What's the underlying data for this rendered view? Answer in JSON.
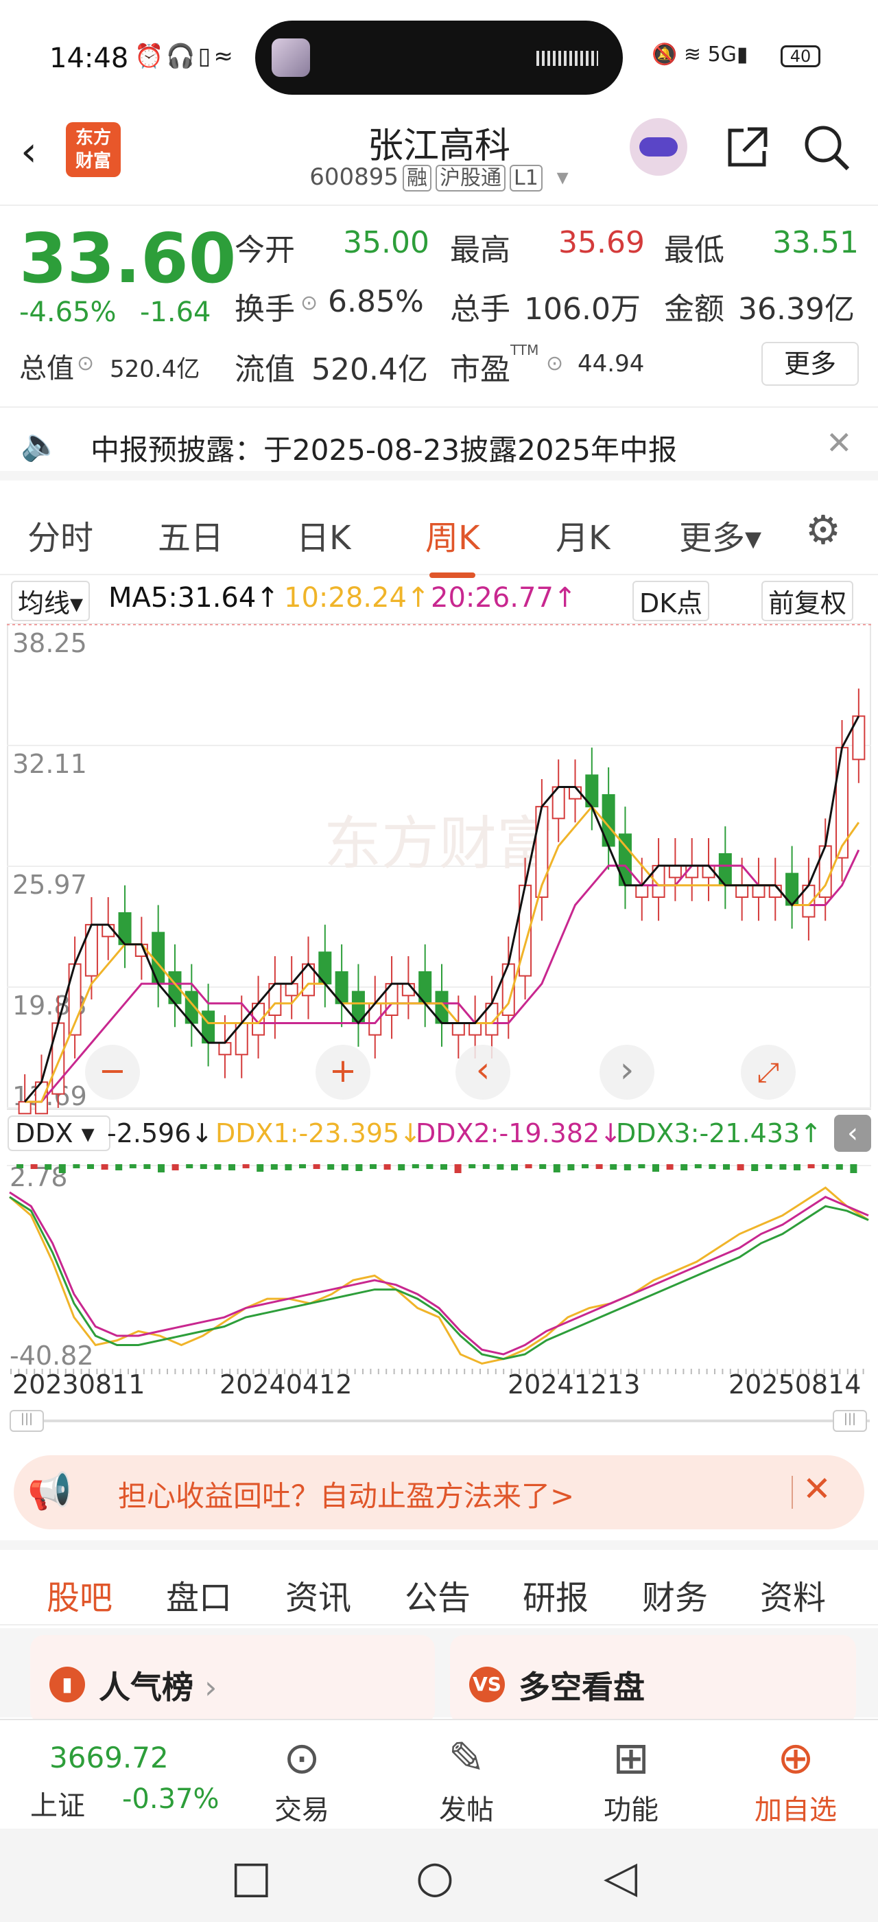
{
  "status_bar": {
    "time": "14:48",
    "left_icons": "⏰🎧▯≈",
    "right_icons": "🔕 ≋ 5G▮",
    "battery": "40"
  },
  "header": {
    "back": "‹",
    "logo_line1": "东方",
    "logo_line2": "财富",
    "title": "张江高科",
    "code": "600895",
    "tag1": "融",
    "tag2": "沪股通",
    "tag3": "L1",
    "caret": "▾"
  },
  "quote": {
    "price": "33.60",
    "pct": "-4.65%",
    "change": "-1.64",
    "open_label": "今开",
    "open": "35.00",
    "high_label": "最高",
    "high": "35.69",
    "low_label": "最低",
    "low": "33.51",
    "turnover_label": "换手",
    "turnover": "6.85%",
    "volume_label": "总手",
    "volume": "106.0万",
    "amount_label": "金额",
    "amount": "36.39亿",
    "mcap_label": "总值",
    "mcap": "520.4亿",
    "float_label": "流值",
    "float": "520.4亿",
    "pe_label": "市盈",
    "pe_sup": "TTM",
    "pe": "44.94",
    "more": "更多"
  },
  "notice": {
    "text": "中报预披露：于2025-08-23披露2025年中报"
  },
  "tabs": [
    "分时",
    "五日",
    "日K",
    "周K",
    "月K",
    "更多▾"
  ],
  "ma_line": {
    "selector": "均线▾",
    "ma5": "MA5:31.64↑",
    "ma10": "10:28.24↑",
    "ma20": "20:26.77↑",
    "dk": "DK点",
    "fq": "前复权"
  },
  "ddx_line": {
    "selector": "DDX ▾",
    "ddx": "-2.596↓",
    "ddx1": "DDX1:-23.395↓",
    "ddx2": "DDX2:-19.382↓",
    "ddx3": "DDX3:-21.433↑"
  },
  "colors": {
    "up": "#d43b3b",
    "down": "#2d9e3a",
    "ma5": "#111111",
    "ma10": "#f0b429",
    "ma20": "#c8278f",
    "accent": "#e0562a"
  },
  "chart_data": {
    "type": "candlestick",
    "y_ticks": [
      "38.25",
      "32.11",
      "25.97",
      "19.83",
      "13.69"
    ],
    "ylim": [
      13.69,
      38.25
    ],
    "x_ticks": [
      "20230811",
      "20240412",
      "20241213",
      "20250814"
    ],
    "watermark": "东方财富",
    "ma5": [
      14,
      15,
      18,
      21,
      23,
      23,
      22,
      22,
      20,
      19,
      18,
      17,
      17,
      18,
      19,
      20,
      20,
      21,
      20,
      19,
      18,
      19,
      20,
      20,
      19,
      18,
      18,
      18,
      19,
      21,
      25,
      29,
      30,
      30,
      29,
      27,
      25,
      25,
      26,
      26,
      26,
      26,
      25,
      25,
      25,
      25,
      24,
      25,
      27,
      32,
      33.6
    ],
    "ma10": [
      14,
      14,
      16,
      18,
      20,
      21,
      22,
      22,
      21,
      20,
      19,
      18,
      18,
      18,
      18,
      19,
      19,
      20,
      20,
      19,
      19,
      19,
      19,
      19,
      19,
      19,
      18,
      18,
      18,
      19,
      22,
      25,
      27,
      28,
      29,
      28,
      27,
      26,
      25,
      25,
      25,
      25,
      25,
      25,
      25,
      25,
      24,
      24,
      25,
      27,
      28.2
    ],
    "ma20": [
      14,
      14,
      15,
      16,
      17,
      18,
      19,
      20,
      20,
      20,
      20,
      19,
      19,
      19,
      18,
      18,
      18,
      18,
      18,
      18,
      18,
      18,
      19,
      19,
      19,
      19,
      19,
      18,
      18,
      18,
      19,
      20,
      22,
      24,
      25,
      26,
      26,
      25,
      25,
      25,
      26,
      26,
      26,
      26,
      25,
      25,
      24,
      24,
      24,
      25,
      26.8
    ],
    "ddx_y_ticks": [
      "2.78",
      "-40.82"
    ],
    "ddx_line": [
      -2,
      -5,
      -12,
      -22,
      -30,
      -33,
      -34,
      -32,
      -31,
      -30,
      -28,
      -27,
      -26,
      -25,
      -24,
      -23,
      -23,
      -22,
      -22,
      -24,
      -26,
      -30,
      -35,
      -37,
      -35,
      -33,
      -30,
      -28,
      -26,
      -24,
      -22,
      -20,
      -18,
      -16,
      -14,
      -12,
      -10,
      -8,
      -5,
      -3,
      -8
    ],
    "ddx1": [
      -4,
      -8,
      -18,
      -30,
      -36,
      -35,
      -33,
      -34,
      -36,
      -34,
      -31,
      -28,
      -26,
      -26,
      -27,
      -25,
      -22,
      -21,
      -24,
      -28,
      -30,
      -38,
      -40,
      -39,
      -37,
      -34,
      -30,
      -28,
      -27,
      -25,
      -22,
      -20,
      -18,
      -15,
      -12,
      -10,
      -8,
      -5,
      -2,
      -6,
      -9
    ],
    "ddx2": [
      -3,
      -6,
      -14,
      -25,
      -32,
      -34,
      -34,
      -33,
      -32,
      -31,
      -30,
      -28,
      -27,
      -26,
      -25,
      -24,
      -23,
      -22,
      -23,
      -25,
      -28,
      -33,
      -37,
      -38,
      -36,
      -33,
      -31,
      -29,
      -27,
      -25,
      -23,
      -21,
      -19,
      -17,
      -15,
      -12,
      -10,
      -7,
      -4,
      -6,
      -8
    ],
    "ddx3": [
      -4,
      -7,
      -16,
      -27,
      -34,
      -36,
      -36,
      -35,
      -34,
      -33,
      -32,
      -30,
      -29,
      -28,
      -27,
      -26,
      -25,
      -24,
      -24,
      -26,
      -29,
      -34,
      -38,
      -39,
      -38,
      -35,
      -33,
      -31,
      -29,
      -27,
      -25,
      -23,
      -21,
      -19,
      -17,
      -14,
      -12,
      -9,
      -6,
      -7,
      -9
    ]
  },
  "ad": {
    "text": "担心收益回吐？自动止盈方法来了>"
  },
  "bottom_tabs": [
    "股吧",
    "盘口",
    "资讯",
    "公告",
    "研报",
    "财务",
    "资料"
  ],
  "cards": {
    "c1": "人气榜",
    "c1_arrow": "›",
    "c2": "多空看盘"
  },
  "bottom_bar": {
    "index_value": "3669.72",
    "index_name": "上证",
    "index_pct": "-0.37%",
    "trade": "交易",
    "post": "发帖",
    "func": "功能",
    "add": "加自选"
  }
}
